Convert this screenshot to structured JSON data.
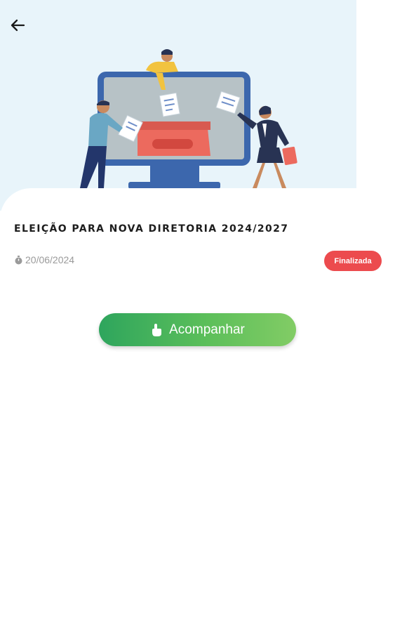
{
  "header": {
    "back_icon": "arrow-left-icon",
    "illustration": "election-ballot-box-illustration"
  },
  "election": {
    "title": "ELEIÇÃO PARA NOVA DIRETORIA 2024/2027",
    "date": "20/06/2024",
    "date_icon": "stopwatch-icon",
    "status": "Finalizada",
    "status_color": "#ec4b4e"
  },
  "actions": {
    "follow_label": "Acompanhar",
    "follow_icon": "hand-pointer-icon"
  },
  "colors": {
    "hero_background": "#e8f4fa",
    "button_gradient_start": "#2ea55d",
    "button_gradient_end": "#82cc65"
  }
}
